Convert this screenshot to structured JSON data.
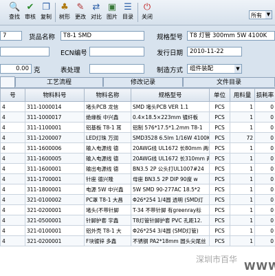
{
  "toolbar": {
    "buttons": [
      {
        "label": "查找",
        "icon": "search-icon"
      },
      {
        "label": "审核",
        "icon": "check-icon"
      },
      {
        "label": "复制",
        "icon": "copy-icon"
      },
      {
        "label": "树形",
        "icon": "tree-icon"
      },
      {
        "label": "更改",
        "icon": "edit-icon"
      },
      {
        "label": "对比",
        "icon": "compare-icon"
      },
      {
        "label": "图片",
        "icon": "image-icon"
      },
      {
        "label": "目录",
        "icon": "catalog-icon"
      },
      {
        "label": "关闭",
        "icon": "close-icon"
      }
    ],
    "filter_value": "所有"
  },
  "form": {
    "part_no_value": "7",
    "name_label": "货品名称",
    "name_value": "T8-1 SMD",
    "spec_label": "规格型号",
    "spec_value": "T8 灯管 300mm 5W 4100K",
    "ecn_label": "ECN编号",
    "ecn_value": "",
    "date_label": "发行日期",
    "date_value": "2010-11-22",
    "qty_value": "0.00",
    "qty_unit": "克",
    "surface_label": "表处理",
    "surface_value": "",
    "method_label": "制造方式",
    "method_value": "组件装配"
  },
  "tabs": [
    "",
    "工艺流程",
    "修改记录",
    "文件目录"
  ],
  "table": {
    "columns": [
      "号",
      "物料料号",
      "物料名称",
      "规格型号",
      "单位",
      "用料量",
      "损耗率"
    ],
    "rows": [
      [
        "4",
        "311-1000014",
        "堵头PCB 龙信",
        "SMD 堵头PCB VER 1.1",
        "PCS",
        "1",
        "0"
      ],
      [
        "4",
        "311-1000017",
        "绝缘板 中兴鑫",
        "0.4×18.5×223mm 镀纤板",
        "PCS",
        "1",
        "0"
      ],
      [
        "4",
        "311-1100001",
        "铝基板 T8-1 耳",
        "铝制 576*17.5*1.2mm T8-1",
        "PCS",
        "1",
        "0"
      ],
      [
        "4",
        "311-1200007",
        "LED灯珠 万润",
        "SMD3528 6.5lm 1/16W 4100K",
        "PCS",
        "72",
        "0"
      ],
      [
        "4",
        "311-1600006",
        "输入电源线 德",
        "20AWG线 UL1672 长80mm 两端",
        "PCS",
        "1",
        "0"
      ],
      [
        "4",
        "311-1600005",
        "输入电源线 德",
        "20AWG线 UL1672 长310mm 两端",
        "PCS",
        "1",
        "0"
      ],
      [
        "4",
        "311-1600001",
        "输出电源线 德",
        "BN3.5 2P 公头打UL1007#24",
        "PCS",
        "1",
        "0"
      ],
      [
        "4",
        "311-1700001",
        "针座 德兴隆",
        "母座 BN3.5 2P  DIP 90度 w",
        "PCS",
        "1",
        "0"
      ],
      [
        "4",
        "311-1800001",
        "电源 5W 中兴鑫",
        "5W   SMD 90-277AC  18.5*2",
        "PCS",
        "1",
        "0"
      ],
      [
        "4",
        "321-0100002",
        "PC罩 T8-1 大昌",
        "Φ26*254 1/4圆 透明 (SMD灯",
        "PCS",
        "1",
        "0"
      ],
      [
        "4",
        "321-0200001",
        "堵头(不带针脚",
        "T-34 不带针脚 有greenray标",
        "PCS",
        "1",
        "0"
      ],
      [
        "4",
        "321-0500001",
        "针脚护套 宇鑫",
        "T8灯管针脚护套 PVC 孔距12.",
        "PCS",
        "1",
        "0"
      ],
      [
        "4",
        "321-0100001",
        "铝外壳 T8-1 大",
        "Φ26*254 3/4圆 (SMD灯管)",
        "PCS",
        "1",
        "0"
      ],
      [
        "4",
        "321-0200001",
        "F块镀锌 多鑫",
        "不锈钢 PA2*18mm 圆头尖尾丝",
        "PCS",
        "1",
        "0"
      ]
    ]
  },
  "watermark": {
    "line1": "深圳市百华",
    "line2": "WWW"
  }
}
